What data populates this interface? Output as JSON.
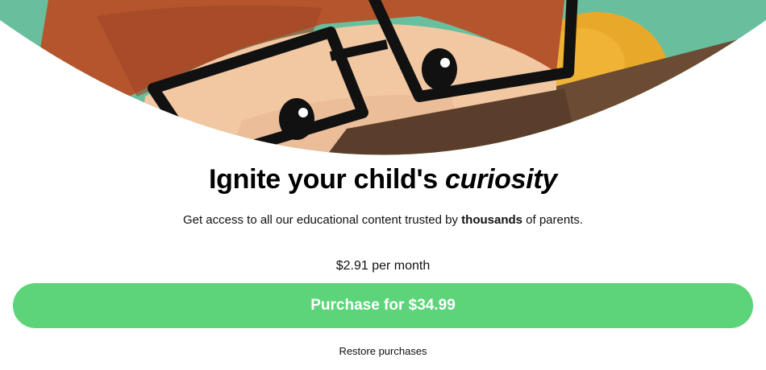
{
  "hero": {
    "image_name": "child-reading-illustration"
  },
  "headline": {
    "prefix": "Ignite your child's ",
    "emphasis": "curiosity"
  },
  "subtitle": {
    "before": "Get access to all our educational content trusted by ",
    "bold": "thousands",
    "after": " of parents."
  },
  "pricing": {
    "monthly_note": "$2.91 per month",
    "purchase_label": "Purchase for $34.99"
  },
  "footer": {
    "restore_label": "Restore purchases"
  },
  "colors": {
    "accent": "#5dd47a",
    "hero_background": "#6fc4a2"
  }
}
